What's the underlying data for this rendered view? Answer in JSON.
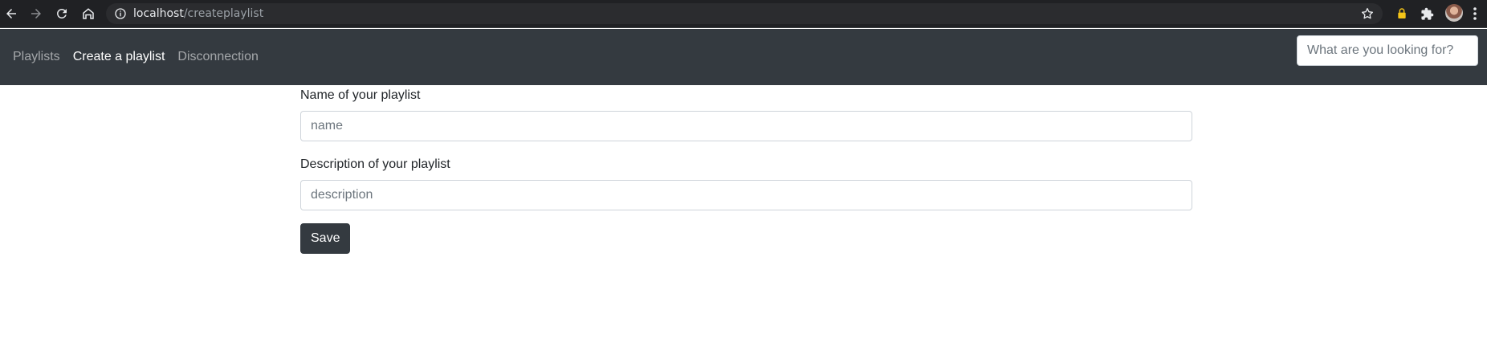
{
  "browser": {
    "url_host": "localhost",
    "url_path": "/createplaylist",
    "icons": [
      "back-icon",
      "forward-icon",
      "reload-icon",
      "home-icon",
      "info-icon",
      "star-icon",
      "lock-extension-icon",
      "puzzle-icon",
      "avatar",
      "menu-dots-icon"
    ]
  },
  "navbar": {
    "links": [
      {
        "label": "Playlists",
        "active": false
      },
      {
        "label": "Create a playlist",
        "active": true
      },
      {
        "label": "Disconnection",
        "active": false
      }
    ],
    "search": {
      "placeholder": "What are you looking for?",
      "value": ""
    }
  },
  "form": {
    "name_label": "Name of your playlist",
    "name_placeholder": "name",
    "description_label": "Description of your playlist",
    "description_placeholder": "description",
    "save_label": "Save"
  },
  "colors": {
    "navbar_bg": "#343a40",
    "button_bg": "#343a40",
    "chrome_bg": "#202124",
    "lock_icon": "#f5c518"
  }
}
